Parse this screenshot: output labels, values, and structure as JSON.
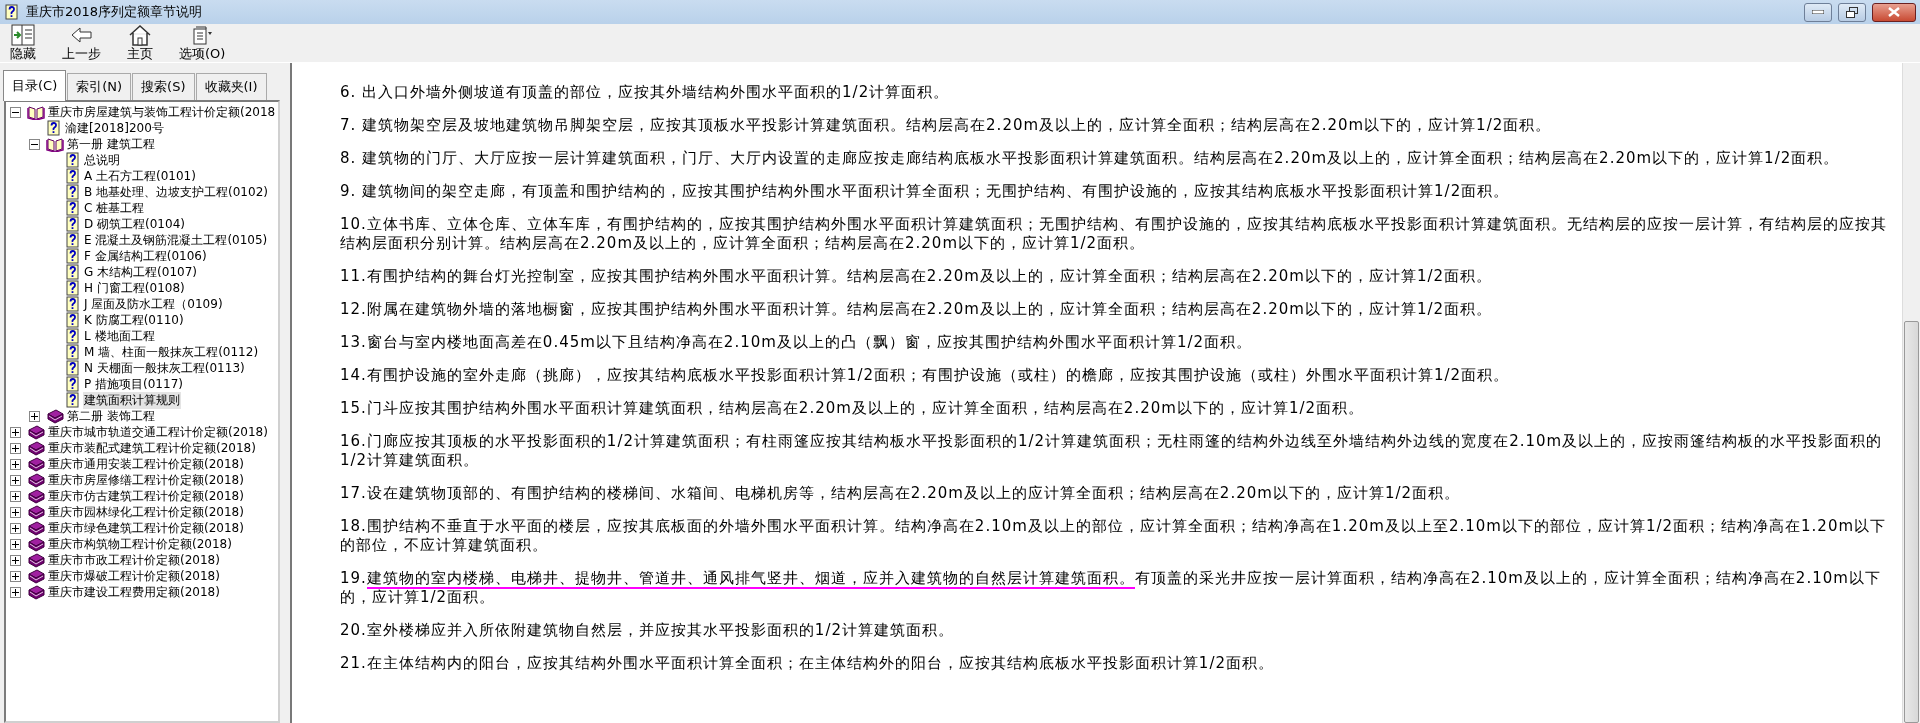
{
  "window": {
    "title": "重庆市2018序列定额章节说明"
  },
  "toolbar": [
    {
      "kind": "hide",
      "label": "隐藏"
    },
    {
      "kind": "back",
      "label": "上一步"
    },
    {
      "kind": "home",
      "label": "主页"
    },
    {
      "kind": "options",
      "label": "选项(O)"
    }
  ],
  "tabs": [
    {
      "label": "目录(C)",
      "selected": true
    },
    {
      "label": "索引(N)",
      "selected": false
    },
    {
      "label": "搜索(S)",
      "selected": false
    },
    {
      "label": "收藏夹(I)",
      "selected": false
    }
  ],
  "tree": [
    {
      "kind": "book",
      "label": "重庆市房屋建筑与装饰工程计价定额(2018",
      "expanded": true,
      "selected": false,
      "children": [
        {
          "kind": "topic",
          "label": "渝建[2018]200号",
          "selected": false
        },
        {
          "kind": "book",
          "label": "第一册 建筑工程",
          "expanded": true,
          "selected": false,
          "children": [
            {
              "kind": "topic",
              "label": "总说明",
              "selected": false
            },
            {
              "kind": "topic",
              "label": "A 土石方工程(0101)",
              "selected": false
            },
            {
              "kind": "topic",
              "label": "B 地基处理、边坡支护工程(0102)",
              "selected": false
            },
            {
              "kind": "topic",
              "label": "C 桩基工程",
              "selected": false
            },
            {
              "kind": "topic",
              "label": "D 砌筑工程(0104)",
              "selected": false
            },
            {
              "kind": "topic",
              "label": "E 混凝土及钢筋混凝土工程(0105)",
              "selected": false
            },
            {
              "kind": "topic",
              "label": "F 金属结构工程(0106)",
              "selected": false
            },
            {
              "kind": "topic",
              "label": "G 木结构工程(0107)",
              "selected": false
            },
            {
              "kind": "topic",
              "label": "H 门窗工程(0108)",
              "selected": false
            },
            {
              "kind": "topic",
              "label": "J 屋面及防水工程（0109)",
              "selected": false
            },
            {
              "kind": "topic",
              "label": "K 防腐工程(0110)",
              "selected": false
            },
            {
              "kind": "topic",
              "label": "L 楼地面工程",
              "selected": false
            },
            {
              "kind": "topic",
              "label": "M 墙、柱面一般抹灰工程(0112)",
              "selected": false
            },
            {
              "kind": "topic",
              "label": "N 天棚面一般抹灰工程(0113)",
              "selected": false
            },
            {
              "kind": "topic",
              "label": "P 措施项目(0117)",
              "selected": false
            },
            {
              "kind": "topic",
              "label": "建筑面积计算规则",
              "selected": true
            }
          ]
        },
        {
          "kind": "book",
          "label": "第二册 装饰工程",
          "expanded": false,
          "selected": false
        }
      ]
    },
    {
      "kind": "book",
      "label": "重庆市城市轨道交通工程计价定额(2018)",
      "expanded": false,
      "selected": false
    },
    {
      "kind": "book",
      "label": "重庆市装配式建筑工程计价定额(2018)",
      "expanded": false,
      "selected": false
    },
    {
      "kind": "book",
      "label": "重庆市通用安装工程计价定额(2018)",
      "expanded": false,
      "selected": false
    },
    {
      "kind": "book",
      "label": "重庆市房屋修缮工程计价定额(2018)",
      "expanded": false,
      "selected": false
    },
    {
      "kind": "book",
      "label": "重庆市仿古建筑工程计价定额(2018)",
      "expanded": false,
      "selected": false
    },
    {
      "kind": "book",
      "label": "重庆市园林绿化工程计价定额(2018)",
      "expanded": false,
      "selected": false
    },
    {
      "kind": "book",
      "label": "重庆市绿色建筑工程计价定额(2018)",
      "expanded": false,
      "selected": false
    },
    {
      "kind": "book",
      "label": "重庆市构筑物工程计价定额(2018)",
      "expanded": false,
      "selected": false
    },
    {
      "kind": "book",
      "label": "重庆市市政工程计价定额(2018)",
      "expanded": false,
      "selected": false
    },
    {
      "kind": "book",
      "label": "重庆市爆破工程计价定额(2018)",
      "expanded": false,
      "selected": false
    },
    {
      "kind": "book",
      "label": "重庆市建设工程费用定额(2018)",
      "expanded": false,
      "selected": false
    }
  ],
  "paragraphs": [
    {
      "text": "6. 出入口外墙外侧坡道有顶盖的部位，应按其外墙结构外围水平面积的1/2计算面积。"
    },
    {
      "text": "7. 建筑物架空层及坡地建筑物吊脚架空层，应按其顶板水平投影计算建筑面积。结构层高在2.20m及以上的，应计算全面积；结构层高在2.20m以下的，应计算1/2面积。"
    },
    {
      "text": "8. 建筑物的门厅、大厅应按一层计算建筑面积，门厅、大厅内设置的走廊应按走廊结构底板水平投影面积计算建筑面积。结构层高在2.20m及以上的，应计算全面积；结构层高在2.20m以下的，应计算1/2面积。"
    },
    {
      "text": "9. 建筑物间的架空走廊，有顶盖和围护结构的，应按其围护结构外围水平面积计算全面积；无围护结构、有围护设施的，应按其结构底板水平投影面积计算1/2面积。"
    },
    {
      "text": "10.立体书库、立体仓库、立体车库，有围护结构的，应按其围护结构外围水平面积计算建筑面积；无围护结构、有围护设施的，应按其结构底板水平投影面积计算建筑面积。无结构层的应按一层计算，有结构层的应按其结构层面积分别计算。结构层高在2.20m及以上的，应计算全面积；结构层高在2.20m以下的，应计算1/2面积。"
    },
    {
      "text": "11.有围护结构的舞台灯光控制室，应按其围护结构外围水平面积计算。结构层高在2.20m及以上的，应计算全面积；结构层高在2.20m以下的，应计算1/2面积。"
    },
    {
      "text": "12.附属在建筑物外墙的落地橱窗，应按其围护结构外围水平面积计算。结构层高在2.20m及以上的，应计算全面积；结构层高在2.20m以下的，应计算1/2面积。"
    },
    {
      "text": "13.窗台与室内楼地面高差在0.45m以下且结构净高在2.10m及以上的凸（飘）窗，应按其围护结构外围水平面积计算1/2面积。"
    },
    {
      "text": "14.有围护设施的室外走廊（挑廊），应按其结构底板水平投影面积计算1/2面积；有围护设施（或柱）的檐廊，应按其围护设施（或柱）外围水平面积计算1/2面积。"
    },
    {
      "text": "15.门斗应按其围护结构外围水平面积计算建筑面积，结构层高在2.20m及以上的，应计算全面积，结构层高在2.20m以下的，应计算1/2面积。"
    },
    {
      "text": "16.门廊应按其顶板的水平投影面积的1/2计算建筑面积；有柱雨篷应按其结构板水平投影面积的1/2计算建筑面积；无柱雨篷的结构外边线至外墙结构外边线的宽度在2.10m及以上的，应按雨篷结构板的水平投影面积的1/2计算建筑面积。"
    },
    {
      "text": "17.设在建筑物顶部的、有围护结构的楼梯间、水箱间、电梯机房等，结构层高在2.20m及以上的应计算全面积；结构层高在2.20m以下的，应计算1/2面积。"
    },
    {
      "text": "18.围护结构不垂直于水平面的楼层，应按其底板面的外墙外围水平面积计算。结构净高在2.10m及以上的部位，应计算全面积；结构净高在1.20m及以上至2.10m以下的部位，应计算1/2面积；结构净高在1.20m以下的部位，不应计算建筑面积。"
    },
    {
      "segments": [
        {
          "text": "19.",
          "marked": false
        },
        {
          "text": "建筑物的室内楼梯、电梯井、提物井、管道井、通风排气竖井、烟道，应并入建筑物的自然层计算建筑面积。",
          "marked": true
        },
        {
          "text": "有顶盖的采光井应按一层计算面积，结构净高在2.10m及以上的，应计算全面积；结构净高在2.10m以下的，应计算1/2面积。",
          "marked": false
        }
      ]
    },
    {
      "text": "20.室外楼梯应并入所依附建筑物自然层，并应按其水平投影面积的1/2计算建筑面积。"
    },
    {
      "text": "21.在主体结构内的阳台，应按其结构外围水平面积计算全面积；在主体结构外的阳台，应按其结构底板水平投影面积计算1/2面积。"
    }
  ]
}
